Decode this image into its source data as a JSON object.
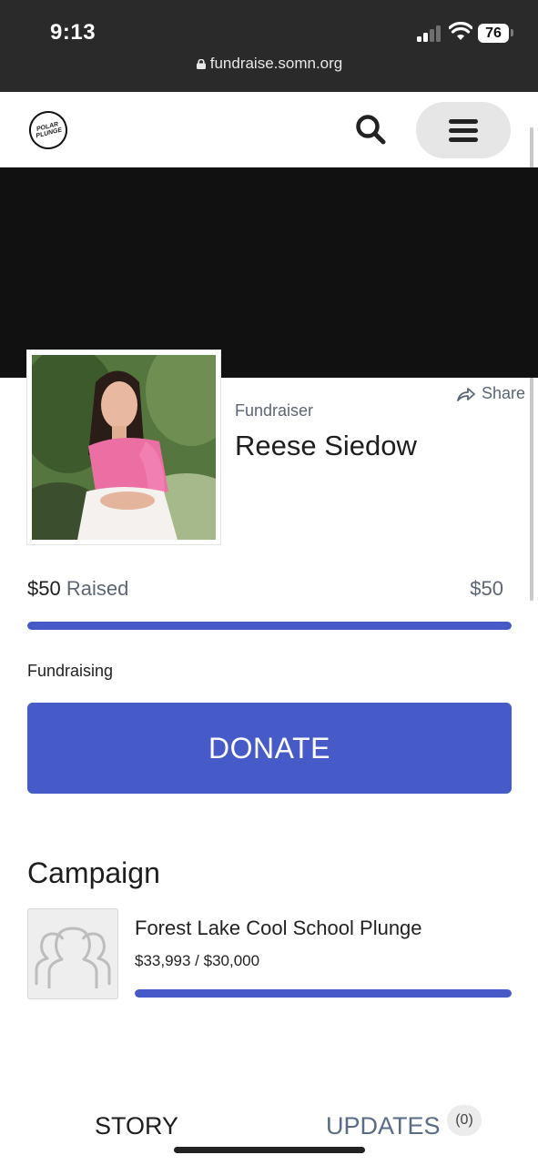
{
  "status_bar": {
    "time": "9:13",
    "battery": "76",
    "url": "fundraise.somn.org"
  },
  "header": {
    "logo_line1": "POLAR",
    "logo_line2": "PLUNGE"
  },
  "profile": {
    "share_label": "Share",
    "role_label": "Fundraiser",
    "name": "Reese Siedow"
  },
  "progress": {
    "raised_amount": "$50",
    "raised_label": "Raised",
    "goal_amount": "$50",
    "fraction": 1.0,
    "status_label": "Fundraising"
  },
  "donate_label": "DONATE",
  "campaign": {
    "heading": "Campaign",
    "name": "Forest Lake Cool School Plunge",
    "amount_text": "$33,993 / $30,000",
    "fraction": 1.0
  },
  "tabs": {
    "story": "STORY",
    "updates": "UPDATES",
    "updates_count": "(0)"
  },
  "colors": {
    "accent": "#475bc8",
    "banner": "#111111",
    "statusbar": "#2a2a2a"
  }
}
